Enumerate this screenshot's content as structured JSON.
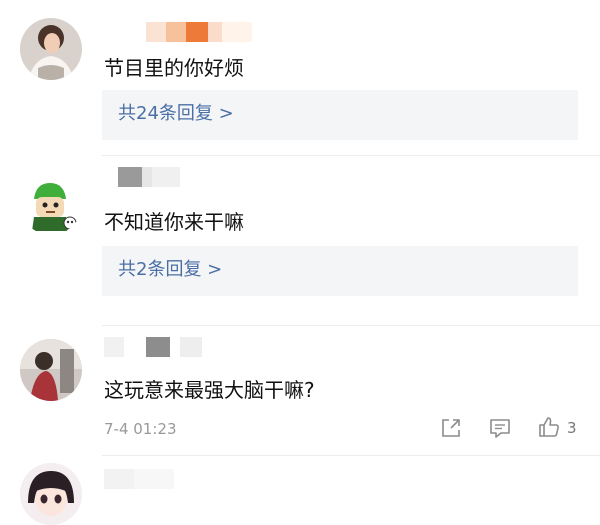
{
  "comments": [
    {
      "text": "节目里的你好烦",
      "reply_label": "共24条回复 >",
      "avatar_icon": "avatar-woman-photo"
    },
    {
      "text": "不知道你来干嘛",
      "reply_label": "共2条回复 >",
      "avatar_icon": "avatar-cartoon-green-hair"
    },
    {
      "text": "这玩意来最强大脑干嘛?",
      "time": "7-4 01:23",
      "like_count": "3",
      "avatar_icon": "avatar-figure-photo"
    },
    {
      "avatar_icon": "avatar-anime-girl"
    }
  ],
  "colors": {
    "reply_link": "#4a6fa5",
    "reply_bg": "#f4f5f7",
    "meta": "#999999"
  }
}
